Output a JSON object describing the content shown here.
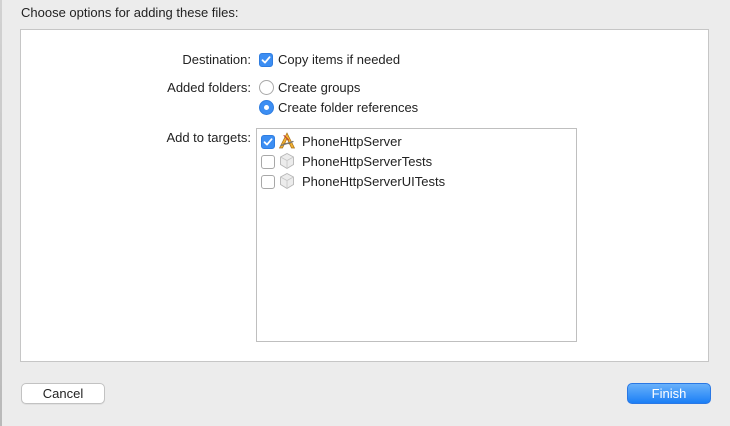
{
  "sheet": {
    "title": "Choose options for adding these files:"
  },
  "destination": {
    "label": "Destination:",
    "copy_items": {
      "label": "Copy items if needed",
      "checked": true
    }
  },
  "added_folders": {
    "label": "Added folders:",
    "options": [
      {
        "label": "Create groups",
        "selected": false
      },
      {
        "label": "Create folder references",
        "selected": true
      }
    ]
  },
  "targets": {
    "label": "Add to targets:",
    "items": [
      {
        "name": "PhoneHttpServer",
        "checked": true,
        "icon": "app-target-icon"
      },
      {
        "name": "PhoneHttpServerTests",
        "checked": false,
        "icon": "test-bundle-icon"
      },
      {
        "name": "PhoneHttpServerUITests",
        "checked": false,
        "icon": "test-bundle-icon"
      }
    ]
  },
  "buttons": {
    "cancel": "Cancel",
    "finish": "Finish"
  },
  "colors": {
    "accent": "#3c8ef3",
    "background": "#ececec",
    "panel": "#ffffff"
  }
}
